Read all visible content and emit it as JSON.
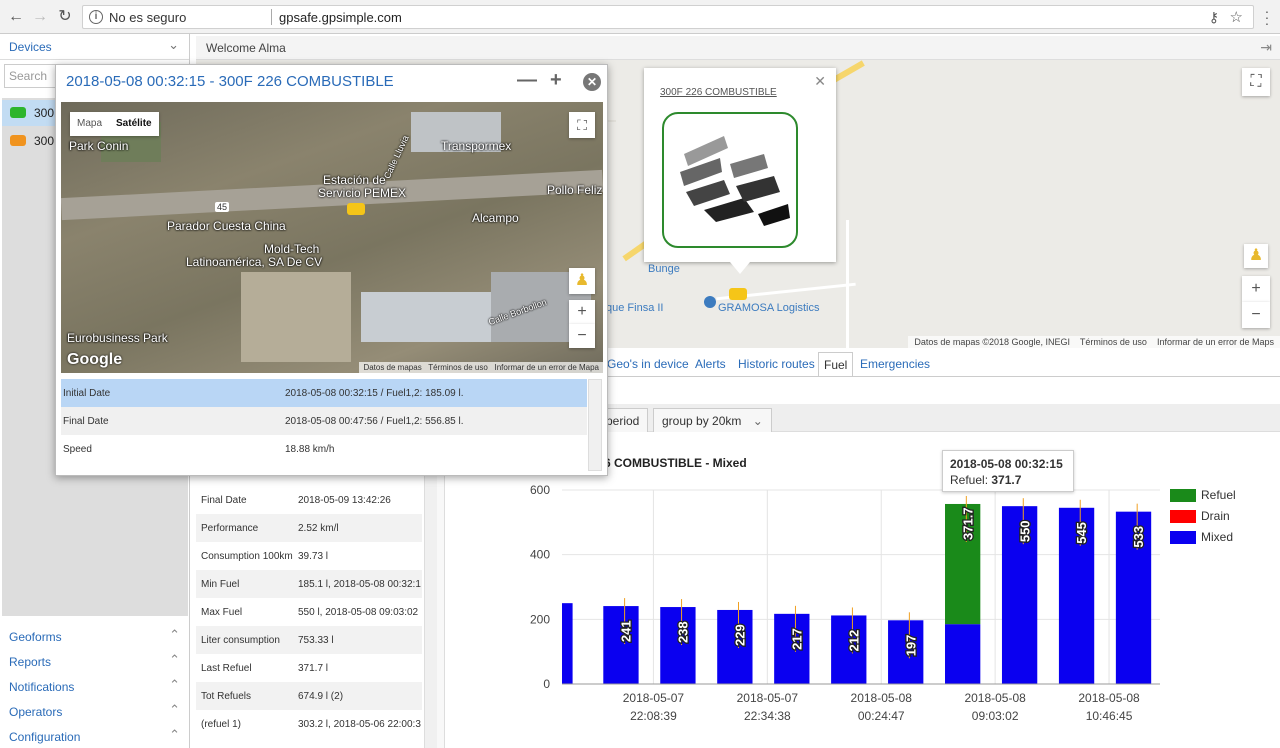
{
  "browser": {
    "security_label": "No es seguro",
    "url": "gpsafe.gpsimple.com"
  },
  "sidebar": {
    "devices_label": "Devices",
    "search_placeholder": "Search",
    "devices": [
      {
        "label": "300F",
        "color": "#2db52d",
        "selected": true
      },
      {
        "label": "300Park Conin",
        "color": "#f0931e",
        "selected": false
      }
    ],
    "sections": [
      "Geoforms",
      "Reports",
      "Notifications",
      "Operators",
      "Configuration"
    ]
  },
  "header": {
    "welcome": "Welcome Alma"
  },
  "main_map": {
    "labels": {
      "bunge": "Bunge",
      "finsa": "que Finsa II",
      "gramosa": "GRAMOSA Logistics"
    },
    "footer": {
      "data": "Datos de mapas ©2018 Google, INEGI",
      "terms": "Términos de uso",
      "report": "Informar de un error de Maps"
    }
  },
  "balloon": {
    "title": "300F 226 COMBUSTIBLE"
  },
  "tabs": [
    "Geo's in device",
    "Alerts",
    "Historic routes",
    "Fuel",
    "Emergencies"
  ],
  "active_tab": "Fuel",
  "toolbar": {
    "period": "period",
    "group": "group by 20km"
  },
  "stats": [
    {
      "k": "Final Date",
      "v": "2018-05-09 13:42:26"
    },
    {
      "k": "Performance",
      "v": "2.52 km/l"
    },
    {
      "k": "Consumption 100km",
      "v": "39.73 l"
    },
    {
      "k": "Min Fuel",
      "v": "185.1 l, 2018-05-08 00:32:1"
    },
    {
      "k": "Max Fuel",
      "v": "550 l, 2018-05-08 09:03:02"
    },
    {
      "k": "Liter consumption",
      "v": "753.33 l"
    },
    {
      "k": "Last Refuel",
      "v": "371.7 l"
    },
    {
      "k": "Tot Refuels",
      "v": "674.9 l (2)"
    },
    {
      "k": "(refuel 1)",
      "v": "303.2 l, 2018-05-06 22:00:3"
    }
  ],
  "popup": {
    "title": "2018-05-08 00:32:15 - 300F 226 COMBUSTIBLE",
    "map_tabs": {
      "map": "Mapa",
      "satellite": "Satélite"
    },
    "places": {
      "transpormex": "Transpormex",
      "estacion": "Estación de",
      "servicio": "Servicio PEMEX",
      "pollo": "Pollo Feliz",
      "parador": "Parador Cuesta China",
      "alcampo": "Alcampo",
      "moldtech": "Mold-Tech",
      "latino": "Latinoamérica, SA De CV",
      "euro": "Eurobusiness Park",
      "conin": "Park Conin",
      "lluvia": "Calle Lluvia",
      "borbollon": "Calle Borbollon",
      "shield": "45"
    },
    "google": "Google",
    "footer": {
      "data": "Datos de mapas",
      "terms": "Términos de uso",
      "report": "Informar de un error de Mapa"
    },
    "rows": [
      {
        "k": "Initial Date",
        "v": "2018-05-08 00:32:15 / Fuel1,2: 185.09 l."
      },
      {
        "k": "Final Date",
        "v": "2018-05-08 00:47:56 / Fuel1,2: 556.85 l."
      },
      {
        "k": "Speed",
        "v": "18.88 km/h"
      }
    ]
  },
  "chart_data": {
    "type": "bar",
    "title": "6 COMBUSTIBLE - Mixed",
    "yticks": [
      0,
      200,
      400,
      600
    ],
    "ylim": [
      0,
      600
    ],
    "xtick_labels": [
      [
        "2018-05-07",
        "22:08:39"
      ],
      [
        "2018-05-07",
        "22:34:38"
      ],
      [
        "2018-05-08",
        "00:24:47"
      ],
      [
        "2018-05-08",
        "09:03:02"
      ],
      [
        "2018-05-08",
        "10:46:45"
      ]
    ],
    "series": [
      {
        "name": "Refuel",
        "color": "#1a8a1a"
      },
      {
        "name": "Drain",
        "color": "#ff0000"
      },
      {
        "name": "Mixed",
        "color": "#0a00f0"
      }
    ],
    "bars": [
      {
        "mixed": 250,
        "refuel": 0,
        "label": ""
      },
      {
        "mixed": 241,
        "refuel": 0,
        "label": "241"
      },
      {
        "mixed": 238,
        "refuel": 0,
        "label": "238"
      },
      {
        "mixed": 229,
        "refuel": 0,
        "label": "229"
      },
      {
        "mixed": 217,
        "refuel": 0,
        "label": "217"
      },
      {
        "mixed": 212,
        "refuel": 0,
        "label": "212"
      },
      {
        "mixed": 197,
        "refuel": 0,
        "label": "197"
      },
      {
        "mixed": 185.1,
        "refuel": 371.7,
        "label": "371.7"
      },
      {
        "mixed": 550,
        "refuel": 0,
        "label": "550"
      },
      {
        "mixed": 545,
        "refuel": 0,
        "label": "545"
      },
      {
        "mixed": 533,
        "refuel": 0,
        "label": "533"
      }
    ],
    "tooltip": {
      "date": "2018-05-08 00:32:15",
      "label": "Refuel:",
      "value": "371.7"
    },
    "legend_position": "right"
  }
}
